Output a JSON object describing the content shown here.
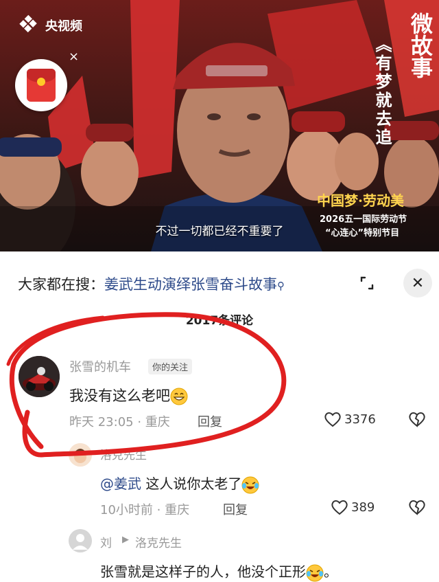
{
  "video": {
    "channel_name": "央视频",
    "close_symbol": "×",
    "series_title": "微故事",
    "episode_title": "《有梦就去追",
    "slogan": "中国梦·劳动美",
    "festival_line1": "2026五一国际劳动节",
    "festival_line2": "“心连心”特别节目",
    "subtitle": "不过一切都已经不重要了"
  },
  "search": {
    "prefix": "大家都在搜：",
    "term": "姜武生动演绎张雪奋斗故事",
    "icon": "search-icon"
  },
  "header": {
    "comment_count": "2017条评论",
    "close_symbol": "✕"
  },
  "comments": [
    {
      "username": "张雪的机车",
      "tag": "你的关注",
      "text": "我没有这么老吧",
      "emoji": "grinning-face",
      "time": "昨天 23:05",
      "location": "重庆",
      "meta": "昨天 23:05 · 重庆",
      "reply_label": "回复",
      "likes": "3376"
    }
  ],
  "replies": [
    {
      "username": "洛克先生",
      "mention": "@姜武",
      "text": "这人说你太老了",
      "emoji": "laughing-tears-face",
      "meta": "10小时前 · 重庆",
      "reply_label": "回复",
      "likes": "389"
    },
    {
      "username": "刘",
      "arrow": "▶",
      "reply_to": "洛克先生",
      "text": "张雪就是这样子的人，他没个正形",
      "text_end": "。",
      "emoji": "laughing-tears-face"
    }
  ],
  "colors": {
    "link": "#2d4a8a",
    "annotation": "#e02020",
    "muted": "#999999"
  }
}
